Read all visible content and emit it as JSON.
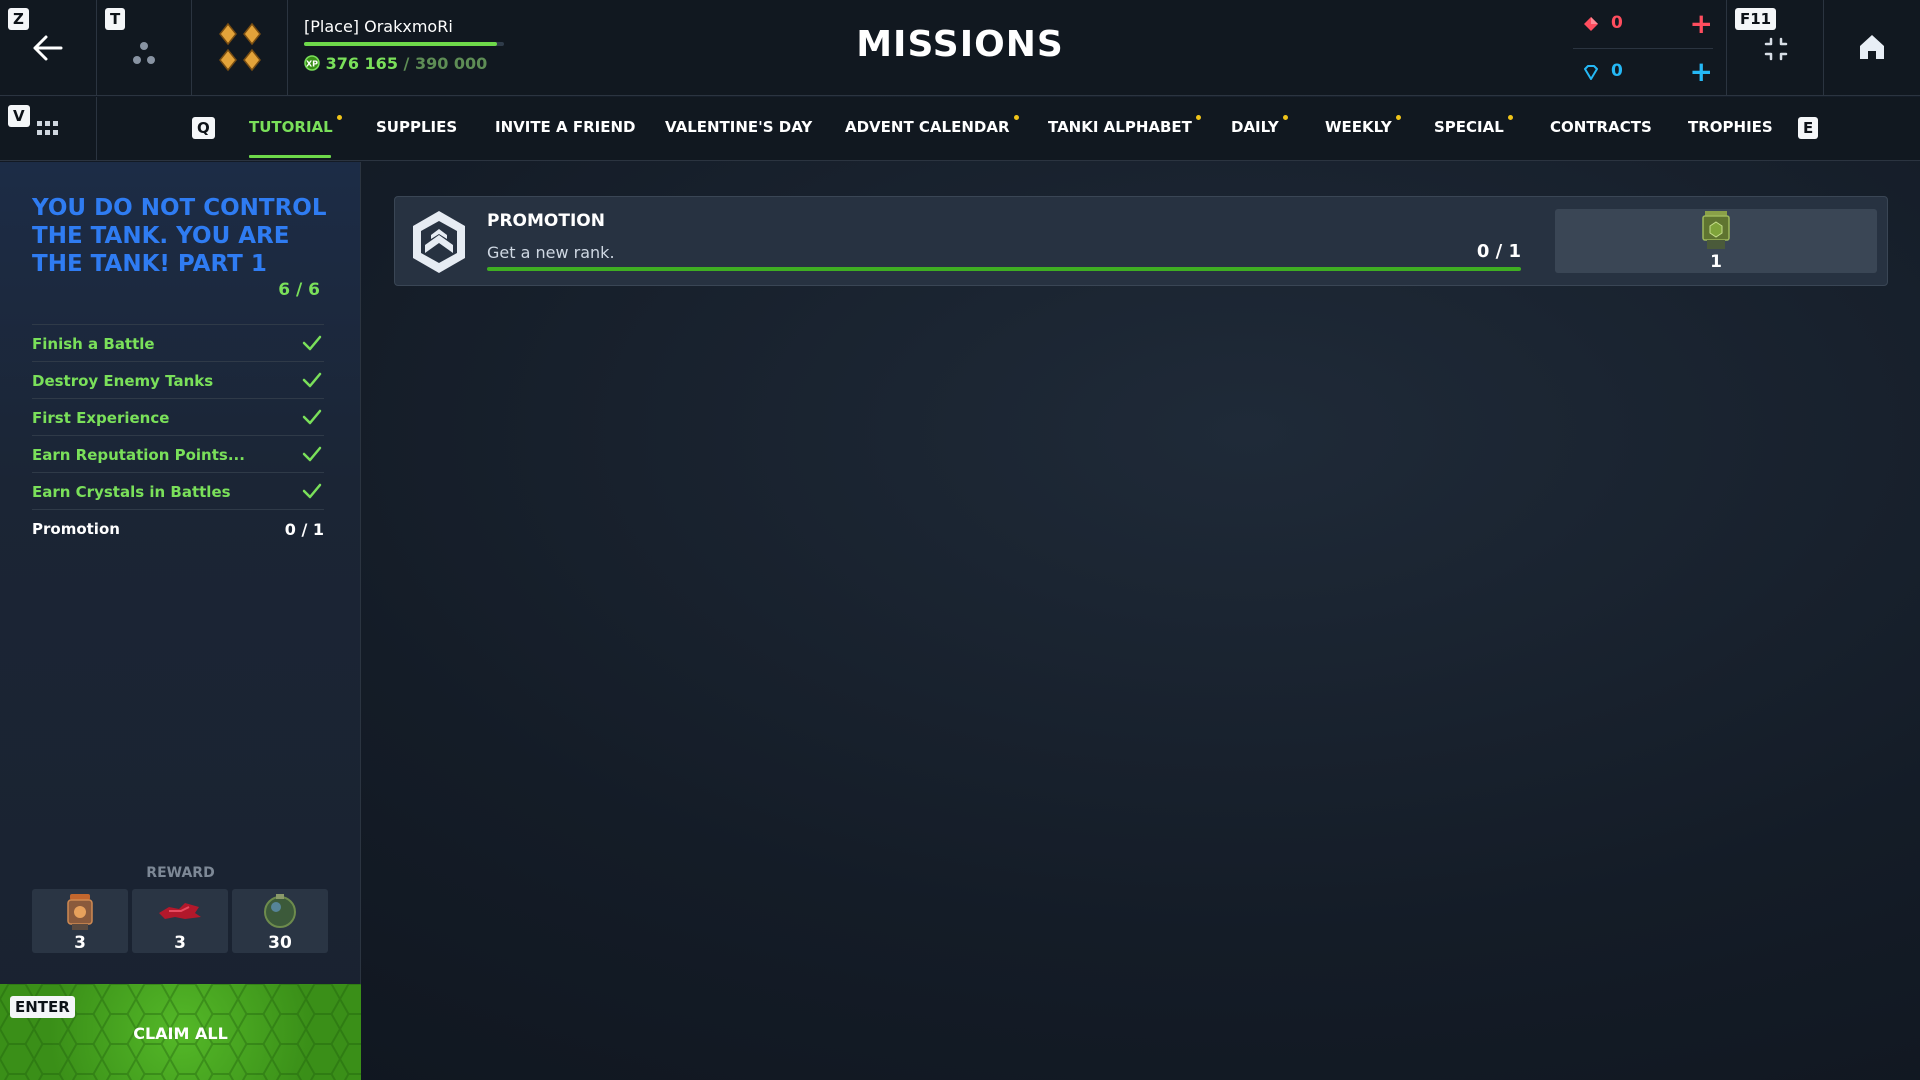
{
  "header": {
    "title": "MISSIONS",
    "player_name": "[Place] OrakxmoRi",
    "xp_current": "376 165",
    "xp_max": "/ 390 000",
    "xp_fraction": 0.9645,
    "back_key": "Z",
    "friends_key": "T",
    "fullscreen_key": "F11",
    "apps_key": "V",
    "ruby_value": "0",
    "crystal_value": "0"
  },
  "tabs": {
    "prev_key": "Q",
    "next_key": "E",
    "items": [
      {
        "label": "TUTORIAL",
        "active": true,
        "dot": true
      },
      {
        "label": "SUPPLIES",
        "active": false,
        "dot": false
      },
      {
        "label": "INVITE A FRIEND",
        "active": false,
        "dot": false
      },
      {
        "label": "VALENTINE'S DAY",
        "active": false,
        "dot": false
      },
      {
        "label": "ADVENT CALENDAR",
        "active": false,
        "dot": true
      },
      {
        "label": "TANKI ALPHABET",
        "active": false,
        "dot": true
      },
      {
        "label": "DAILY",
        "active": false,
        "dot": true
      },
      {
        "label": "WEEKLY",
        "active": false,
        "dot": true
      },
      {
        "label": "SPECIAL",
        "active": false,
        "dot": true
      },
      {
        "label": "CONTRACTS",
        "active": false,
        "dot": false
      },
      {
        "label": "TROPHIES",
        "active": false,
        "dot": false
      }
    ]
  },
  "chain": {
    "title": "YOU DO NOT CONTROL THE TANK. YOU ARE THE TANK! PART 1",
    "progress": "6 / 6",
    "missions": [
      {
        "name": "Finish a Battle",
        "completed": true
      },
      {
        "name": "Destroy Enemy Tanks",
        "completed": true
      },
      {
        "name": "First Experience",
        "completed": true
      },
      {
        "name": "Earn Reputation Points...",
        "completed": true
      },
      {
        "name": "Earn Crystals in Battles",
        "completed": true
      },
      {
        "name": "Promotion",
        "completed": false,
        "count": "0 / 1"
      }
    ],
    "reward_label": "REWARD",
    "rewards": [
      {
        "icon": "booster-container-icon",
        "qty": "3"
      },
      {
        "icon": "red-paint-icon",
        "qty": "3"
      },
      {
        "icon": "grenade-orb-icon",
        "qty": "30"
      }
    ],
    "claim_key": "ENTER",
    "claim_label": "CLAIM ALL"
  },
  "mission_card": {
    "title": "PROMOTION",
    "description": "Get a new rank.",
    "progress": "0 / 1",
    "reward_qty": "1",
    "reward_icon": "green-container-icon"
  },
  "colors": {
    "accent_green": "#7ae05a",
    "title_blue": "#2f7cf2",
    "ruby_red": "#ff4d5e",
    "crystal_blue": "#25b8f5",
    "tab_dot": "#f0c419"
  }
}
